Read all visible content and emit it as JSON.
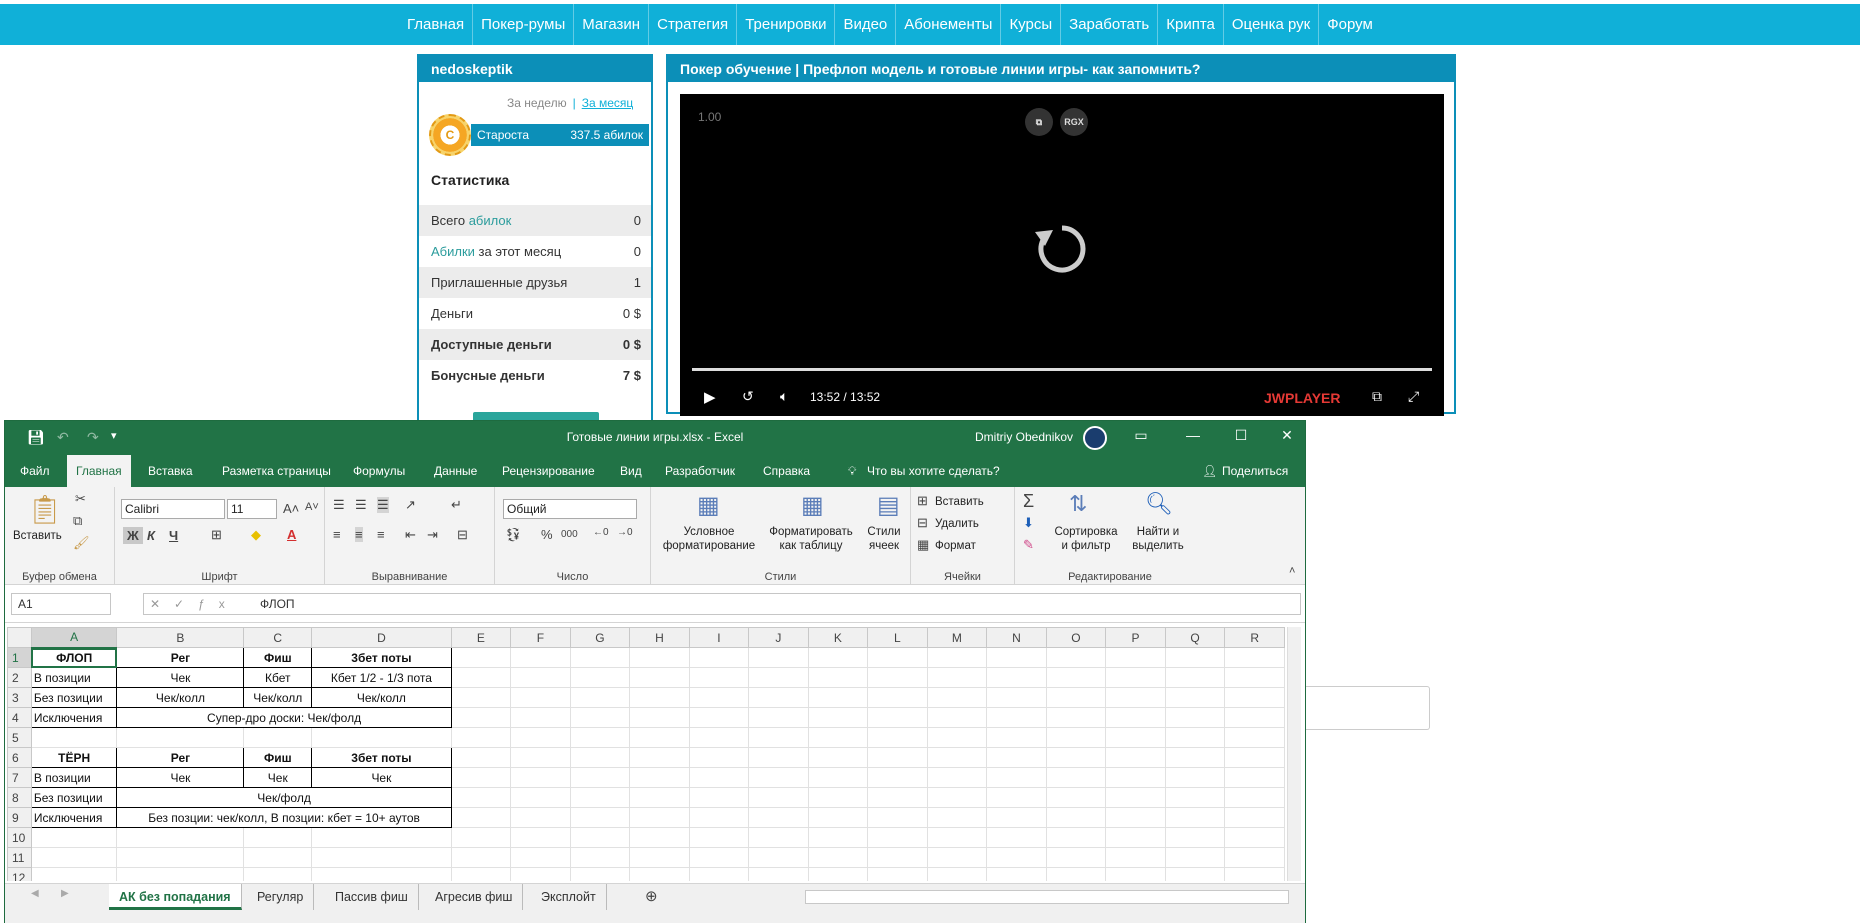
{
  "nav": [
    "Главная",
    "Покер-румы",
    "Магазин",
    "Стратегия",
    "Тренировки",
    "Видео",
    "Абонементы",
    "Курсы",
    "Заработать",
    "Крипта",
    "Оценка рук",
    "Форум"
  ],
  "user": {
    "name": "nedoskeptik",
    "period_week": "За неделю",
    "period_month": "За месяц",
    "coin_letter": "C",
    "rank": "Староста",
    "points": "337.5 абилок",
    "stats_title": "Статистика",
    "stats": [
      {
        "pre": "Всего ",
        "accent": "абилок",
        "post": "",
        "value": "0"
      },
      {
        "pre": "",
        "accent": "Абилки",
        "post": " за этот месяц",
        "value": "0"
      },
      {
        "pre": "Приглашенные друзья",
        "accent": "",
        "post": "",
        "value": "1"
      },
      {
        "pre": "Деньги",
        "accent": "",
        "post": "",
        "value": "0 $"
      },
      {
        "pre": "Доступные деньги",
        "accent": "",
        "post": "",
        "value": "0 $"
      },
      {
        "pre": "Бонусные деньги",
        "accent": "",
        "post": "",
        "value": "7 $"
      }
    ]
  },
  "video": {
    "title": "Покер обучение | Префлоп модель и готовые линии игры- как запомнить?",
    "speed": "1.00",
    "rgx": "RGX",
    "time": "13:52  /  13:52",
    "brand": "JWPLAYER",
    "progress": 1.0
  },
  "excel": {
    "filename": "Готовые линии игры.xlsx  -  Excel",
    "user": "Dmitriy Obednikov",
    "tabs": [
      "Файл",
      "Главная",
      "Вставка",
      "Разметка страницы",
      "Формулы",
      "Данные",
      "Рецензирование",
      "Вид",
      "Разработчик",
      "Справка",
      "Что вы хотите сделать?"
    ],
    "share": "Поделиться",
    "ribbon": {
      "paste": "Вставить",
      "clipboard": "Буфер обмена",
      "font_name": "Calibri",
      "font_size": "11",
      "bold": "Ж",
      "italic": "К",
      "underline": "Ч",
      "font_group": "Шрифт",
      "align_group": "Выравнивание",
      "number_format": "Общий",
      "number_group": "Число",
      "cond_format": "Условное форматирование",
      "format_table": "Форматировать как таблицу",
      "cell_styles": "Стили ячеек",
      "styles_group": "Стили",
      "insert": "Вставить",
      "delete": "Удалить",
      "format": "Формат",
      "cells_group": "Ячейки",
      "sort_filter": "Сортировка и фильтр",
      "find_select": "Найти и выделить",
      "editing_group": "Редактирование"
    },
    "name_box": "A1",
    "formula": "ФЛОП",
    "columns": [
      "A",
      "B",
      "C",
      "D",
      "E",
      "F",
      "G",
      "H",
      "I",
      "J",
      "K",
      "L",
      "M",
      "N",
      "O",
      "P",
      "Q",
      "R"
    ],
    "rows": [
      {
        "n": "1",
        "a": "ФЛОП",
        "b": "Рег",
        "c": "Фиш",
        "d": "3бет поты"
      },
      {
        "n": "2",
        "a": "В позиции",
        "b": "Чек",
        "c": "Кбет",
        "d": "Кбет 1/2 - 1/3 пота"
      },
      {
        "n": "3",
        "a": "Без позиции",
        "b": "Чек/колл",
        "c": "Чек/колл",
        "d": "Чек/колл"
      },
      {
        "n": "4",
        "a": "Исключения",
        "merged": "Супер-дро доски: Чек/фолд"
      },
      {
        "n": "5"
      },
      {
        "n": "6",
        "a": "ТЁРН",
        "b": "Рег",
        "c": "Фиш",
        "d": "3бет поты"
      },
      {
        "n": "7",
        "a": "В позиции",
        "b": "Чек",
        "c": "Чек",
        "d": "Чек"
      },
      {
        "n": "8",
        "a": "Без позиции",
        "merged": "Чек/фолд"
      },
      {
        "n": "9",
        "a": "Исключения",
        "merged": "Без позции: чек/колл, В позции: кбет = 10+ аутов"
      },
      {
        "n": "10"
      },
      {
        "n": "11"
      },
      {
        "n": "12"
      }
    ],
    "sheets": [
      "АК без попадания",
      "Регуляр",
      "Пассив фиш",
      "Агресив фиш",
      "Эксплойт"
    ]
  }
}
